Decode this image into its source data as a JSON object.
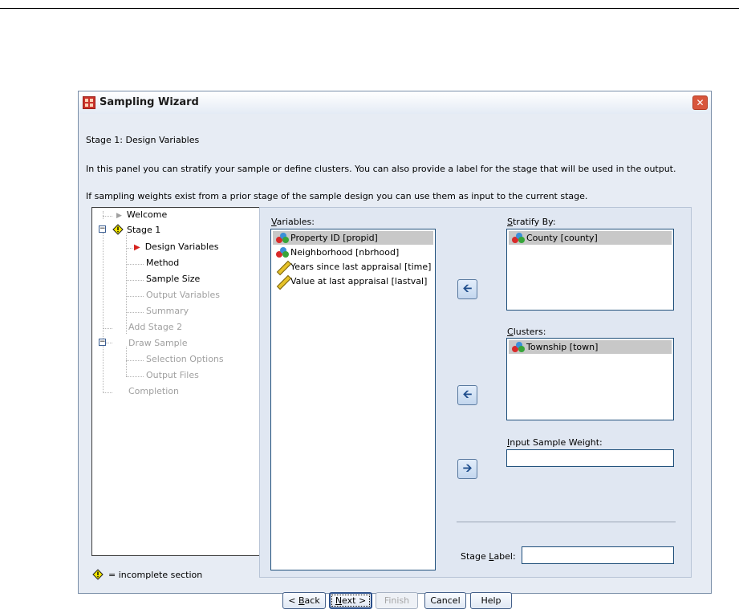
{
  "window": {
    "title": "Sampling Wizard",
    "close_glyph": "✕",
    "icon": "spreadsheet-app-icon"
  },
  "header": {
    "stage_title": "Stage 1: Design Variables",
    "description": "In this panel you can stratify your sample or define clusters. You can also provide a label for the stage that will be used in the output.",
    "weights_note": "If sampling weights exist from a prior stage of the sample design you can use them as input to the current stage."
  },
  "tree": {
    "welcome": "Welcome",
    "stage1": "Stage 1",
    "design_variables": "Design Variables",
    "method": "Method",
    "sample_size": "Sample Size",
    "output_variables": "Output Variables",
    "summary": "Summary",
    "add_stage2": "Add Stage 2",
    "draw_sample": "Draw Sample",
    "selection_options": "Selection Options",
    "output_files": "Output Files",
    "completion": "Completion",
    "legend": "= incomplete section"
  },
  "variables": {
    "label_first": "V",
    "label_rest": "ariables:",
    "items": [
      {
        "label": "Property ID [propid]",
        "icon": "nominal-icon"
      },
      {
        "label": "Neighborhood [nbrhood]",
        "icon": "nominal-icon"
      },
      {
        "label": "Years since last appraisal [time]",
        "icon": "scale-icon"
      },
      {
        "label": "Value at last appraisal [lastval]",
        "icon": "scale-icon"
      }
    ]
  },
  "stratify": {
    "label_first": "S",
    "label_rest": "tratify By:",
    "items": [
      "County [county]"
    ]
  },
  "clusters": {
    "label_first": "C",
    "label_rest": "lusters:",
    "items": [
      "Township [town]"
    ]
  },
  "weight": {
    "label_first": "I",
    "label_rest": "nput Sample Weight:",
    "value": ""
  },
  "stage_label": {
    "label_pre": "Stage ",
    "label_u": "L",
    "label_post": "abel:",
    "value": ""
  },
  "arrows": {
    "left": "🡨",
    "right": "🡪"
  },
  "buttons": {
    "back_pre": "< ",
    "back_u": "B",
    "back_post": "ack",
    "next_u": "N",
    "next_post": "ext >",
    "finish": "Finish",
    "cancel": "Cancel",
    "help": "Help"
  },
  "colors": {
    "incomplete_icon": "#f2e600",
    "current_marker": "#d6231e",
    "list_selected": "#c8c8c8"
  }
}
